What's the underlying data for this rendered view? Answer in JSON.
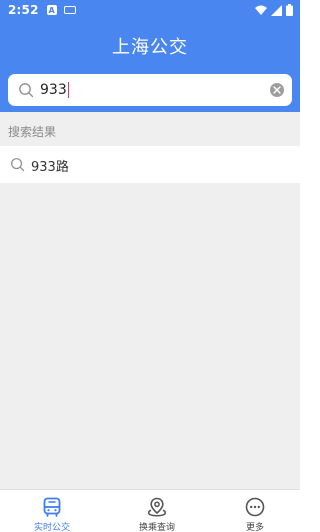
{
  "status_bar": {
    "time": "2:52",
    "a_icon_letter": "A"
  },
  "header": {
    "title": "上海公交"
  },
  "search": {
    "value": "933"
  },
  "results": {
    "section_label": "搜索结果",
    "items": [
      {
        "label": "933路"
      }
    ]
  },
  "bottom_nav": {
    "items": [
      {
        "label": "实时公交",
        "icon": "bus-icon",
        "active": true
      },
      {
        "label": "换乘查询",
        "icon": "transfer-route-icon",
        "active": false
      },
      {
        "label": "更多",
        "icon": "more-icon",
        "active": false
      }
    ]
  },
  "colors": {
    "primary": "#4a86f0",
    "active_tab": "#3c7ef0",
    "background": "#efefef",
    "caret": "#e03a67"
  }
}
